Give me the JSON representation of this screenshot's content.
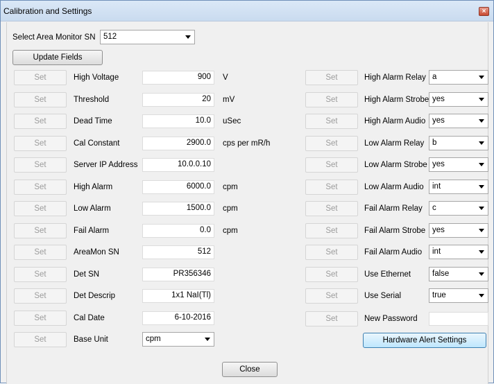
{
  "window": {
    "title": "Calibration and Settings",
    "close_glyph": "×"
  },
  "monitor": {
    "label": "Select Area Monitor SN",
    "value": "512"
  },
  "update_label": "Update Fields",
  "set_label": "Set",
  "left_rows": [
    {
      "name": "High Voltage",
      "value": "900",
      "unit": "V"
    },
    {
      "name": "Threshold",
      "value": "20",
      "unit": "mV"
    },
    {
      "name": "Dead Time",
      "value": "10.0",
      "unit": "uSec"
    },
    {
      "name": "Cal Constant",
      "value": "2900.0",
      "unit": "cps per mR/h"
    },
    {
      "name": "Server IP Address",
      "value": "10.0.0.10",
      "unit": ""
    },
    {
      "name": "High Alarm",
      "value": "6000.0",
      "unit": "cpm"
    },
    {
      "name": "Low Alarm",
      "value": "1500.0",
      "unit": "cpm"
    },
    {
      "name": "Fail Alarm",
      "value": "0.0",
      "unit": "cpm"
    },
    {
      "name": "AreaMon SN",
      "value": "512",
      "unit": ""
    },
    {
      "name": "Det SN",
      "value": "PR356346",
      "unit": ""
    },
    {
      "name": "Det Descrip",
      "value": "1x1 NaI(Tl)",
      "unit": ""
    },
    {
      "name": "Cal Date",
      "value": "6-10-2016",
      "unit": ""
    }
  ],
  "base_unit": {
    "name": "Base Unit",
    "value": "cpm"
  },
  "right_rows": [
    {
      "name": "High Alarm Relay",
      "value": "a"
    },
    {
      "name": "High Alarm Strobe",
      "value": "yes"
    },
    {
      "name": "High Alarm Audio",
      "value": "yes"
    },
    {
      "name": "Low Alarm Relay",
      "value": "b"
    },
    {
      "name": "Low Alarm Strobe",
      "value": "yes"
    },
    {
      "name": "Low Alarm Audio",
      "value": "int"
    },
    {
      "name": "Fail Alarm Relay",
      "value": "c"
    },
    {
      "name": "Fail Alarm Strobe",
      "value": "yes"
    },
    {
      "name": "Fail Alarm Audio",
      "value": "int"
    },
    {
      "name": "Use Ethernet",
      "value": "false"
    },
    {
      "name": "Use Serial",
      "value": "true"
    }
  ],
  "password": {
    "name": "New Password",
    "value": ""
  },
  "hardware_label": "Hardware Alert Settings",
  "close_label": "Close"
}
